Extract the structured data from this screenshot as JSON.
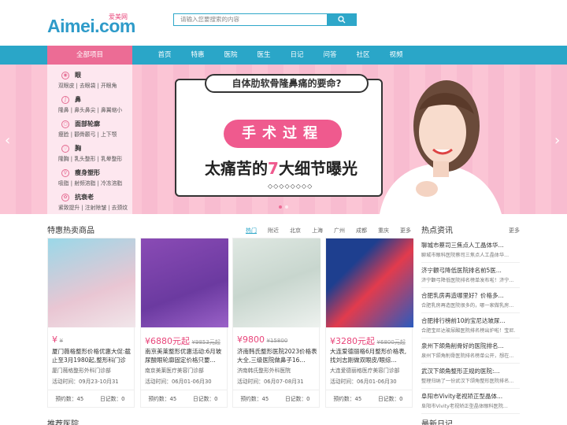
{
  "header": {
    "logo_en": "Aimei.com",
    "logo_cn": "爱美网",
    "search_placeholder": "请输入您要搜索的内容"
  },
  "nav": {
    "all_label": "全部项目",
    "items": [
      "首页",
      "特惠",
      "医院",
      "医生",
      "日记",
      "问答",
      "社区",
      "视频"
    ]
  },
  "sidebar": [
    {
      "icon": "eye-icon",
      "title": "眼",
      "sub": "双眼皮 | 去眼袋 | 开眼角"
    },
    {
      "icon": "nose-icon",
      "title": "鼻",
      "sub": "隆鼻 | 鼻头鼻尖 | 鼻翼缩小"
    },
    {
      "icon": "face-icon",
      "title": "面部轮廓",
      "sub": "瘦脸 | 颧骨颧弓 | 上下颚"
    },
    {
      "icon": "chest-icon",
      "title": "胸",
      "sub": "隆胸 | 乳头整形 | 乳晕整形"
    },
    {
      "icon": "body-icon",
      "title": "瘦身塑形",
      "sub": "吸脂 | 射频溶脂 | 冷冻溶脂"
    },
    {
      "icon": "antiaging-icon",
      "title": "抗衰老",
      "sub": "紧致提升 | 注射除皱 | 去颈纹"
    }
  ],
  "banner": {
    "question": "自体肋软骨隆鼻痛的要命?",
    "pill": "手术过程",
    "headline_pre": "太痛苦的",
    "headline_num": "7",
    "headline_post": "大细节曝光",
    "dots": "◇◇◇◇◇◇◇◇"
  },
  "hot": {
    "title": "特惠热卖商品",
    "cities": [
      "热门",
      "附近",
      "北京",
      "上海",
      "广州",
      "成都",
      "重庆"
    ],
    "more": "更多"
  },
  "products": [
    {
      "price": "¥",
      "orig": "¥",
      "title": "厦门薇格整形价格优惠大促:截止至3月1980起,整形科门诊",
      "hospital": "厦门薇格整形外科门诊部",
      "date": "活动时间：09月23-10月31",
      "reserve": "预约数：45",
      "diary": "日记数：0"
    },
    {
      "price": "¥6880元起",
      "orig": "¥9853元起",
      "title": "南京美莱整形优惠活动:6月玻尿酸眼轮廓固定价格只要...",
      "hospital": "南京美莱医疗美容门诊部",
      "date": "活动时间：06月01-06月30",
      "reserve": "预约数：45",
      "diary": "日记数：0"
    },
    {
      "price": "¥9800",
      "orig": "¥15800",
      "title": "济南韩氏整形医院2023价格表大全,三级医院做鼻子16...",
      "hospital": "济南韩氏整形外科医院",
      "date": "活动时间：06月07-08月31",
      "reserve": "预约数：45",
      "diary": "日记数：0"
    },
    {
      "price": "¥3280元起",
      "orig": "¥6800元起",
      "title": "大连爱德丽格6月整形价格表,找刘志刚做双眼皮/眼综...",
      "hospital": "大连爱德丽格医疗美容门诊部",
      "date": "活动时间：06月01-06月30",
      "reserve": "预约数：45",
      "diary": "日记数：0"
    }
  ],
  "news": {
    "title": "热点资讯",
    "more": "更多",
    "items": [
      {
        "a": "聊城市蔡司三焦点人工晶体华...",
        "b": "聊城市眼科医院蔡司三焦点人工晶体华..."
      },
      {
        "a": "济宁颧弓降低医院排名前5医...",
        "b": "济宁颧弓降低医院排名榜单发布啦！济宁..."
      },
      {
        "a": "合肥乳房再造哪里好？价格多...",
        "b": "合肥乳房再造医院很多的，哪一家做乳房..."
      },
      {
        "a": "合肥排行榜前10的宝尼达玻尿...",
        "b": "合肥宝尼达玻尿酸医院排名榜出炉啦！宝尼..."
      },
      {
        "a": "泉州下颌角削骨好的医院排名...",
        "b": "泉州下颌角削骨医院排名榜单公开，想在..."
      },
      {
        "a": "武汉下颌角整形正规的医院:...",
        "b": "整理归纳了一份武汉下颌角整形医院排名..."
      },
      {
        "a": "阜阳市Vivity老视矫正型晶体...",
        "b": "阜阳市Vivity老视矫正型晶体眼科医院..."
      }
    ]
  },
  "bottom": {
    "left": "推荐医院",
    "right": "最新日记"
  }
}
